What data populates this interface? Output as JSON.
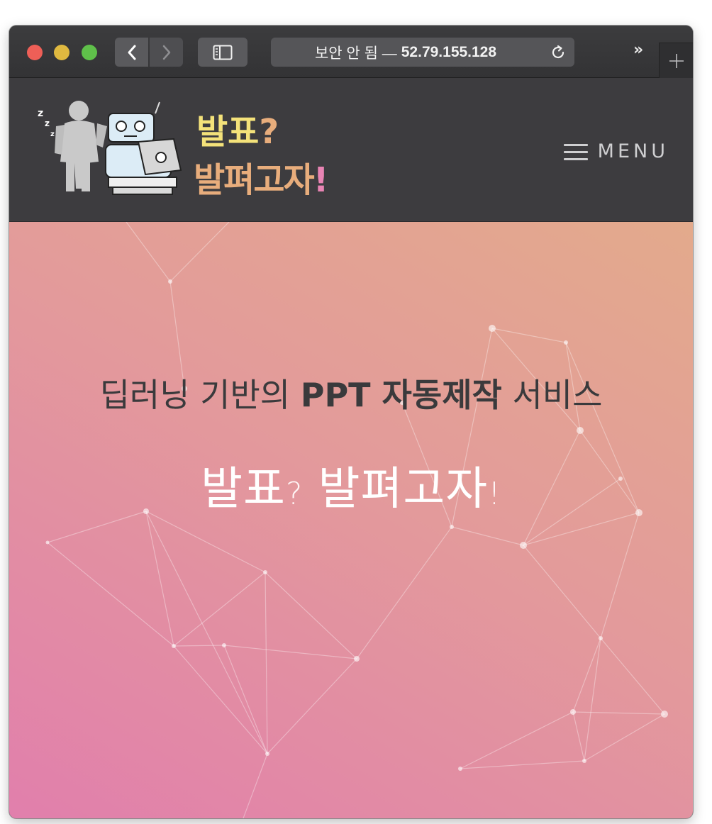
{
  "browser": {
    "address_security": "보안 안 됨 —",
    "address_host": "52.79.155.128",
    "more_label": "»"
  },
  "header": {
    "logo": {
      "line1": "발표",
      "line1_mark": "?",
      "line2": "발펴고자",
      "line2_mark": "!",
      "colors": {
        "yellow": "#f4e27a",
        "peach": "#e8ad7c",
        "pink": "#e984b4"
      }
    },
    "menu_label": "MENU"
  },
  "hero": {
    "title_prefix": "딥러닝 기반의 ",
    "title_bold": "PPT 자동제작",
    "title_suffix": " 서비스",
    "subtitle_a": "발표",
    "subtitle_q": "?",
    "subtitle_b": " 발펴고자",
    "subtitle_excl": "!"
  },
  "colors": {
    "toolbar": "#3c3c3e",
    "header_bg": "#3d3c3f",
    "hero_gradient": [
      "#e17fac",
      "#e39a9b",
      "#e3aa8c"
    ]
  }
}
